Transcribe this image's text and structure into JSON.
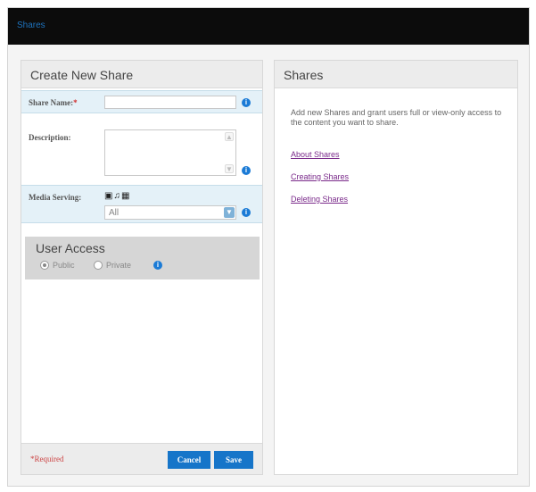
{
  "topbar": {
    "title": "Shares"
  },
  "create_panel": {
    "header": "Create New Share",
    "share_name": {
      "label": "Share Name:",
      "required_mark": "*",
      "value": ""
    },
    "description": {
      "label": "Description:",
      "value": ""
    },
    "media_serving": {
      "label": "Media Serving:",
      "icons": [
        "camera-icon",
        "music-note-icon",
        "film-icon"
      ],
      "selected": "All"
    },
    "user_access": {
      "title": "User Access",
      "options": [
        {
          "label": "Public",
          "selected": true
        },
        {
          "label": "Private",
          "selected": false
        }
      ]
    },
    "footer": {
      "required_note": "*Required",
      "cancel_label": "Cancel",
      "save_label": "Save"
    }
  },
  "info_panel": {
    "header": "Shares",
    "description": "Add new Shares and grant users full or view-only access to the content you want to share.",
    "links": [
      "About Shares",
      "Creating Shares",
      "Deleting Shares"
    ]
  },
  "colors": {
    "accent": "#1675c9",
    "topbar": "#0c0c0c",
    "highlight_row": "#e4f1f8",
    "link": "#7a2a8a",
    "required": "#c44444"
  }
}
